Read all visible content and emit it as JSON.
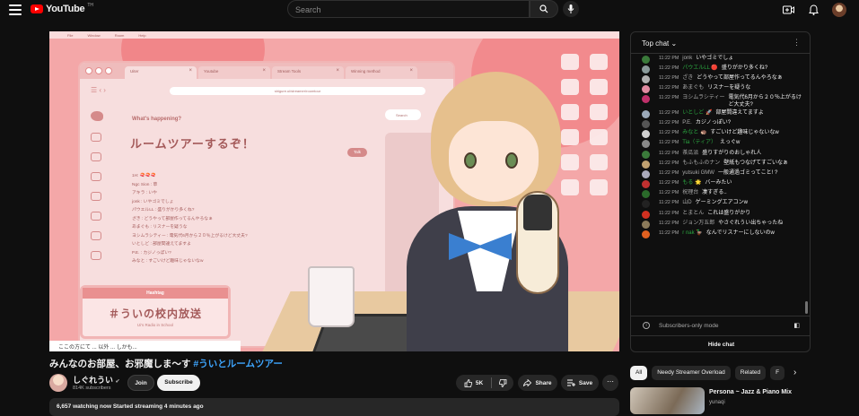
{
  "header": {
    "logo_text": "YouTube",
    "logo_sup": "TH",
    "search_placeholder": "Search"
  },
  "video": {
    "title_main": "みんなのお部屋、お邪魔しま〜す ",
    "title_tag": "#ういとルームツアー",
    "overlay": {
      "top_menu": [
        "File",
        "Window",
        "Room",
        "Help"
      ],
      "tabs": [
        {
          "label": "Uiter"
        },
        {
          "label": "Youtube"
        },
        {
          "label": "Stream Tools"
        },
        {
          "label": "Winning method"
        }
      ],
      "address": "shigure.ui/streamer/roomtour",
      "whats_happening": "What's happening?",
      "compose_text": "ルームツアーするぞ！",
      "post_btn": "Talk",
      "search_label": "Search",
      "inner_chat": [
        "1H: 🍣🍣🍣",
        "Ngc Sion : 草",
        "アキラ : いや",
        "jonk : いやゴミでしょ",
        "パウエルLL : 盛りがかり多くね?",
        "ざき : どうやって部屋作ってるんやろなぁ",
        "あまぐも : リスナーを疑うな",
        "ヨシムラシティー : 電気代6月から２０％上がるけど大丈夫?",
        "いとしど : 部屋間違えてますよ",
        "P.E. : カジノっぽい?",
        "みなと : すごいけど趣味じゃないなw"
      ],
      "hashtag_title": "Hashtag",
      "hashtag_main": "＃ういの校内放送",
      "hashtag_sub": "Ui's Radio in School",
      "caption": "ここの方にて ... 以外 ... しかも..."
    }
  },
  "channel": {
    "name": "しぐれうい",
    "verified_icon": "✔",
    "subs": "814K subscribers",
    "join": "Join",
    "subscribe": "Subscribe"
  },
  "actions": {
    "likes": "5K",
    "share": "Share",
    "save": "Save"
  },
  "description": {
    "stats": "6,657 watching now  Started streaming 4 minutes ago"
  },
  "chat": {
    "header": "Top chat",
    "messages": [
      {
        "time": "11:22 PM",
        "user": "jonk",
        "text": "いやゴミでしょ",
        "color": "#3a7a3a",
        "green": false
      },
      {
        "time": "11:22 PM",
        "user": "パウエルLL 🔴",
        "text": "盛りがかり多くね?",
        "color": "#8a9a9a",
        "green": true
      },
      {
        "time": "11:22 PM",
        "user": "ざき",
        "text": "どうやって部屋作ってるんやろなぁ",
        "color": "#b0b0b0",
        "green": false
      },
      {
        "time": "11:22 PM",
        "user": "あまぐも",
        "text": "リスナーを疑うな",
        "color": "#e08aa0",
        "green": false
      },
      {
        "time": "11:22 PM",
        "user": "ヨシムラシティー",
        "text": "電気代6月から２０％上がるけど大丈夫?",
        "color": "#c0306a",
        "green": false
      },
      {
        "time": "11:22 PM",
        "user": "いとしど 🚀",
        "text": "部屋間違えてますよ",
        "color": "#9aa8b8",
        "green": true
      },
      {
        "time": "11:22 PM",
        "user": "P.E.",
        "text": "カジノっぽい?",
        "color": "#555",
        "green": false
      },
      {
        "time": "11:22 PM",
        "user": "みなと 🦔",
        "text": "すごいけど趣味じゃないなw",
        "color": "#d0d0d0",
        "green": true
      },
      {
        "time": "11:22 PM",
        "user": "Tia（ティア）",
        "text": "えっぐw",
        "color": "#888",
        "green": true
      },
      {
        "time": "11:22 PM",
        "user": "茶瓜派",
        "text": "盛りすがりのおしゃれ人",
        "color": "#3a7a3a",
        "green": false
      },
      {
        "time": "11:22 PM",
        "user": "もふもふのナン",
        "text": "壁紙もつなげてすごいなぁ",
        "color": "#c0a070",
        "green": false
      },
      {
        "time": "11:22 PM",
        "user": "yutsuki GMW",
        "text": "一般通過ゴミってこと! ?",
        "color": "#aab",
        "green": false
      },
      {
        "time": "11:22 PM",
        "user": "もる 🌟",
        "text": "バーみたい",
        "color": "#c03030",
        "green": true
      },
      {
        "time": "11:22 PM",
        "user": "祝理台",
        "text": "凄すぎる..",
        "color": "#2a6a2a",
        "green": false
      },
      {
        "time": "11:22 PM",
        "user": "山D",
        "text": "ゲーミングエアコンw",
        "color": "#222",
        "green": false
      },
      {
        "time": "11:22 PM",
        "user": "とまとん",
        "text": "これは盛りがかり",
        "color": "#d03020",
        "green": false
      },
      {
        "time": "11:22 PM",
        "user": "ジョン万五郎",
        "text": "やさぐれうい出ちゃったね",
        "color": "#8a7a5a",
        "green": false
      },
      {
        "time": "11:22 PM",
        "user": "r nak 🦆",
        "text": "なんでリスナーにしないのw",
        "color": "#e06020",
        "green": true
      }
    ],
    "subscribers_only": "Subscribers-only mode",
    "hide_chat": "Hide chat"
  },
  "chips": [
    "All",
    "Needy Streamer Overload",
    "Related",
    "F"
  ],
  "recommend": {
    "title": "Persona ~ Jazz & Piano Mix",
    "channel": "yunaqi"
  },
  "colors": {
    "accent_red": "#ff0000",
    "link_blue": "#3ea6ff",
    "bg": "#0f0f0f"
  }
}
